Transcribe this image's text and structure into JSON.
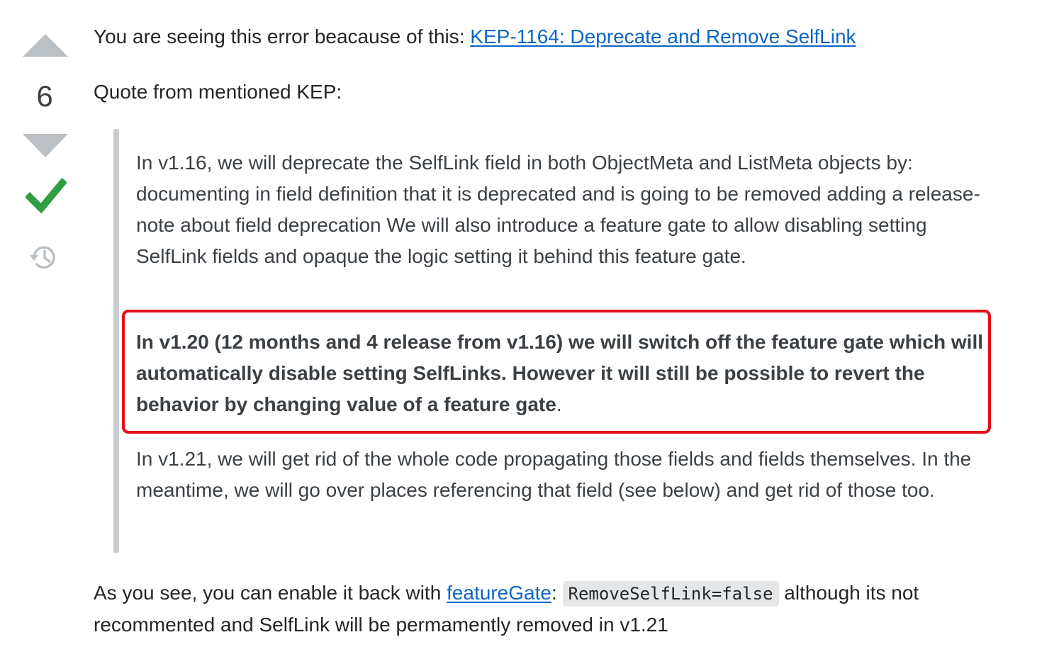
{
  "votes": {
    "count": "6",
    "upvote_icon": "triangle-up-icon",
    "downvote_icon": "triangle-down-icon",
    "accepted_icon": "checkmark-icon",
    "history_icon": "history-icon"
  },
  "answer": {
    "intro_text": "You are seeing this error beacause of this: ",
    "kep_link": "KEP-1164: Deprecate and Remove SelfLink",
    "quote_intro": "Quote from mentioned KEP:",
    "blockquote": {
      "para1": "In v1.16, we will deprecate the SelfLink field in both ObjectMeta and ListMeta objects by: documenting in field definition that it is deprecated and is going to be removed adding a release-note about field deprecation We will also introduce a feature gate to allow disabling setting SelfLink fields and opaque the logic setting it behind this feature gate.",
      "para2_bold": "In v1.20 (12 months and 4 release from v1.16) we will switch off the feature gate which will automatically disable setting SelfLinks. However it will still be possible to revert the behavior by changing value of a feature gate",
      "para2_tail": ".",
      "para3": "In v1.21, we will get rid of the whole code propagating those fields and fields themselves. In the meantime, we will go over places referencing that field (see below) and get rid of those too."
    },
    "outro_pre": "As you see, you can enable it back with ",
    "feature_gate_link": "featureGate",
    "outro_colon": ": ",
    "code": "RemoveSelfLink=false",
    "outro_post": " although its not recommented and SelfLink will be permamently removed in v1.21"
  },
  "colors": {
    "accent_link": "#0c65c6",
    "accepted_green": "#2f9e44",
    "highlight_red": "#e60b1a",
    "vote_gray": "#bbc0c4"
  }
}
